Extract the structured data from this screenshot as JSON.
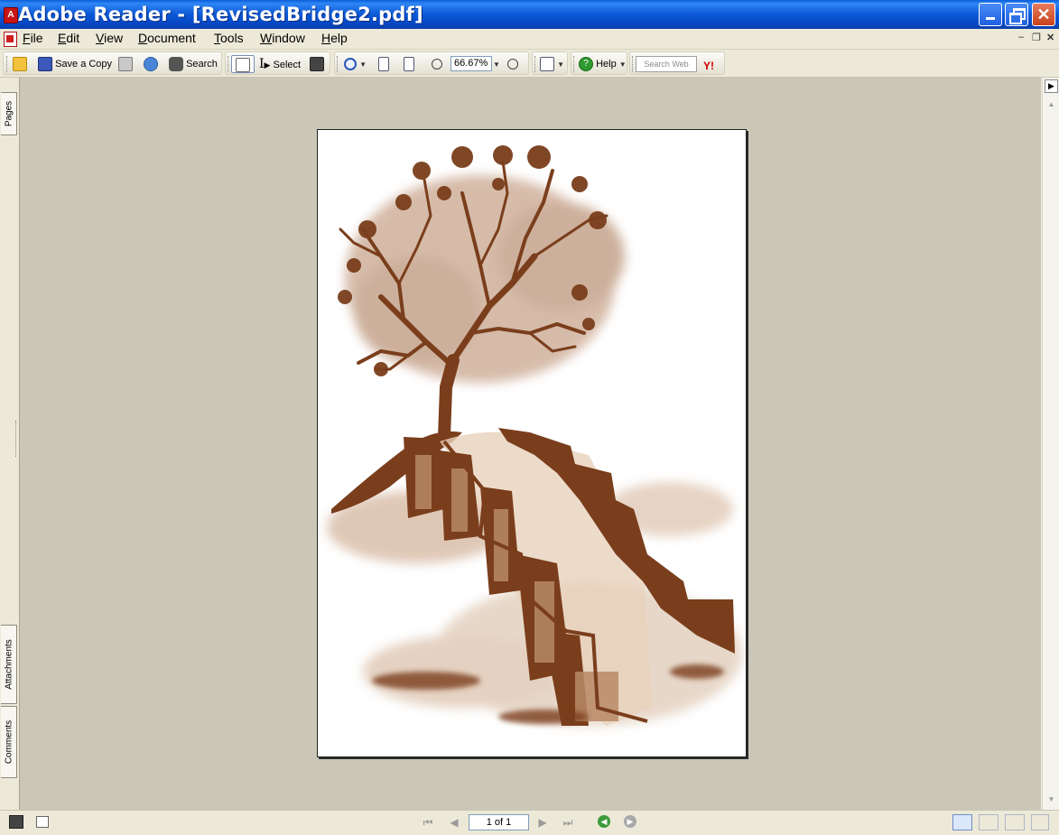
{
  "window": {
    "title": "Adobe Reader - [RevisedBridge2.pdf]",
    "app_icon": "adobe-reader-icon"
  },
  "menu": {
    "items": [
      {
        "label": "File",
        "accel": "F",
        "rest": "ile"
      },
      {
        "label": "Edit",
        "accel": "E",
        "rest": "dit"
      },
      {
        "label": "View",
        "accel": "V",
        "rest": "iew"
      },
      {
        "label": "Document",
        "accel": "D",
        "rest": "ocument"
      },
      {
        "label": "Tools",
        "accel": "T",
        "rest": "ools"
      },
      {
        "label": "Window",
        "accel": "W",
        "rest": "indow"
      },
      {
        "label": "Help",
        "accel": "H",
        "rest": "elp"
      }
    ]
  },
  "toolbar": {
    "save_copy_label": "Save a Copy",
    "search_label": "Search",
    "select_label": "Select",
    "zoom_value": "66.67%",
    "help_label": "Help",
    "search_web_placeholder": "Search Web"
  },
  "leftnav": {
    "tabs": [
      "Pages",
      "Attachments",
      "Comments"
    ]
  },
  "status": {
    "page_indicator": "1 of 1"
  },
  "colors": {
    "titlebar": "#0b58d6",
    "doc_background": "#cbc7b8",
    "illustration_brown": "#7a3e1c"
  }
}
